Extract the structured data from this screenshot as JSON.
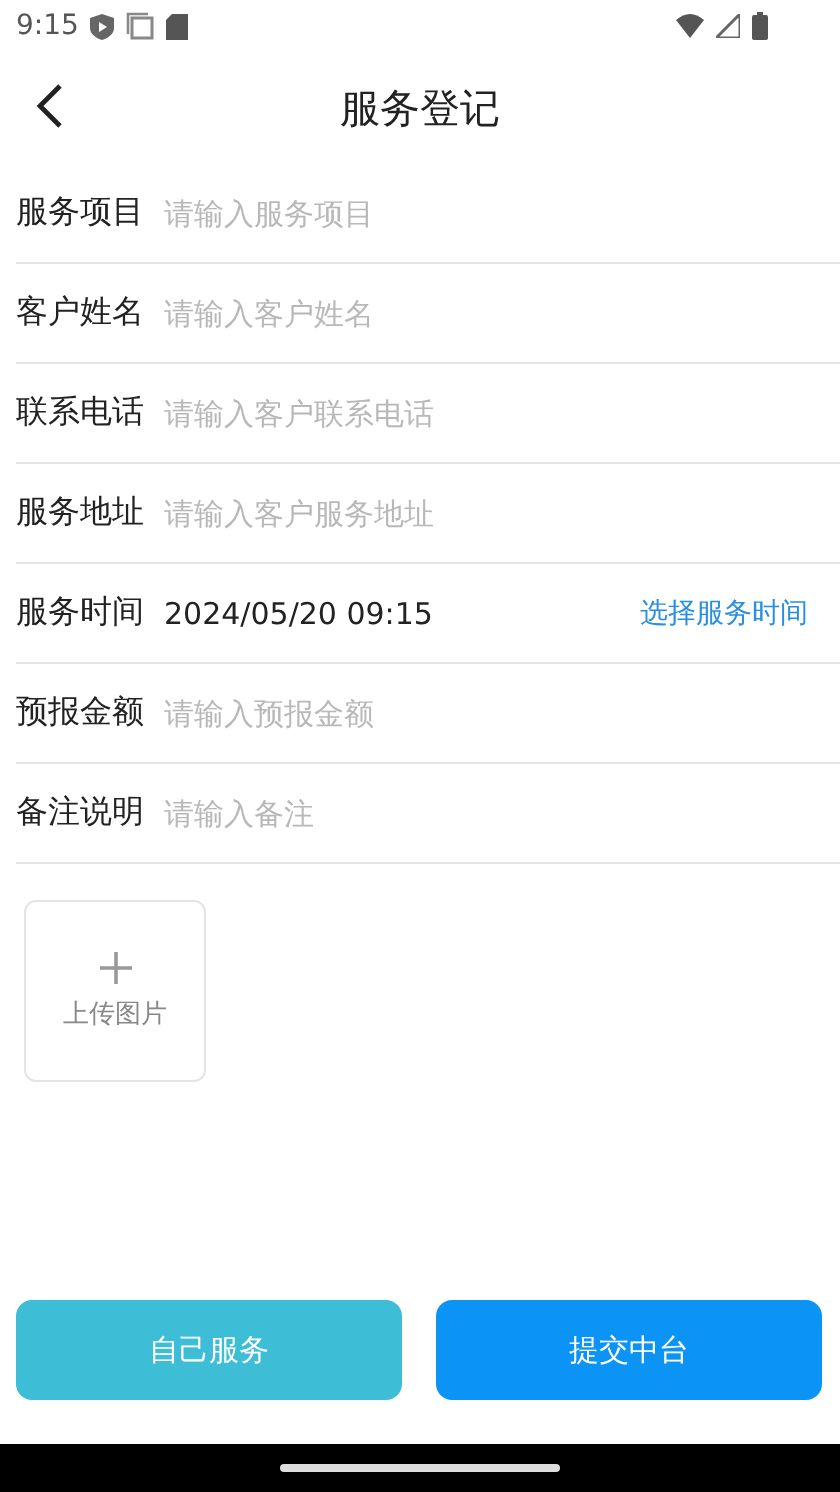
{
  "status_bar": {
    "time": "9:15"
  },
  "header": {
    "title": "服务登记"
  },
  "fields": [
    {
      "kind": "input",
      "label": "服务项目",
      "placeholder": "请输入服务项目"
    },
    {
      "kind": "input",
      "label": "客户姓名",
      "placeholder": "请输入客户姓名"
    },
    {
      "kind": "input",
      "label": "联系电话",
      "placeholder": "请输入客户联系电话"
    },
    {
      "kind": "input",
      "label": "服务地址",
      "placeholder": "请输入客户服务地址"
    },
    {
      "kind": "picker",
      "label": "服务时间",
      "value": "2024/05/20 09:15",
      "action": "选择服务时间"
    },
    {
      "kind": "input",
      "label": "预报金额",
      "placeholder": "请输入预报金额"
    },
    {
      "kind": "input",
      "label": "备注说明",
      "placeholder": "请输入备注"
    }
  ],
  "upload": {
    "label": "上传图片"
  },
  "buttons": [
    {
      "label": "自己服务",
      "kind": "secondary"
    },
    {
      "label": "提交中台",
      "kind": "primary"
    }
  ]
}
